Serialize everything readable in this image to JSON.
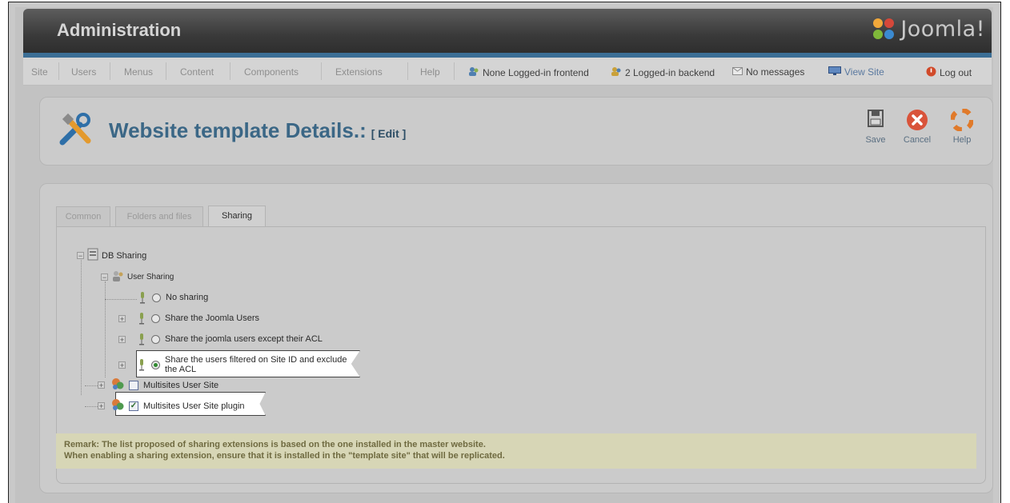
{
  "header": {
    "title": "Administration",
    "logo_text": "Joomla!"
  },
  "menu": {
    "items": [
      "Site",
      "Users",
      "Menus",
      "Content",
      "Components",
      "Extensions",
      "Help"
    ],
    "status": {
      "frontend": "None Logged-in frontend",
      "backend": "2 Logged-in backend",
      "messages": "No messages",
      "view_site": "View Site",
      "logout": "Log out"
    }
  },
  "toolbar": {
    "title": "Website template Details.:",
    "subtitle": "[ Edit ]",
    "save_label": "Save",
    "cancel_label": "Cancel",
    "help_label": "Help"
  },
  "tabs": [
    "Common",
    "Folders and files",
    "Sharing"
  ],
  "tree": {
    "root": "DB Sharing",
    "user_sharing": "User Sharing",
    "options": [
      "No sharing",
      "Share the Joomla Users",
      "Share the joomla users except their ACL",
      "Share the users filtered on Site ID and exclude the ACL"
    ],
    "plugins": [
      "Multisites User Site",
      "Multisites User Site plugin"
    ]
  },
  "remark": {
    "line1": "Remark: The list proposed of sharing extensions is based on the one installed in the master website.",
    "line2": "When enabling a sharing extension, ensure that it is installed in the \"template site\" that will be replicated."
  },
  "colors": {
    "header_bg": "#3a3a3a",
    "accent_stripe": "#3b6e95",
    "title_blue": "#3b6786",
    "remark_bg": "#d7d6b6",
    "cancel_red": "#d9533a",
    "help_orange": "#e07a2a"
  }
}
